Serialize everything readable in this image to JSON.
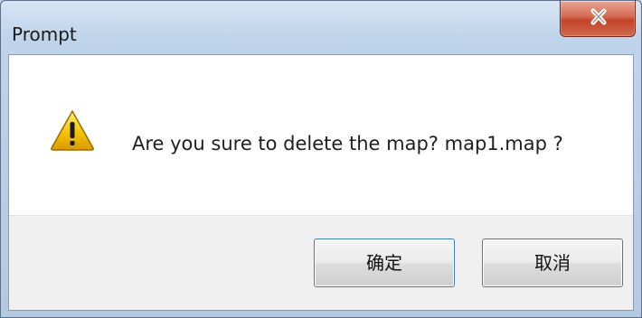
{
  "window": {
    "title": "Prompt"
  },
  "message": {
    "text": "Are you sure to delete the map? map1.map ?",
    "icon": "warning-icon"
  },
  "buttons": {
    "ok_label": "确定",
    "cancel_label": "取消"
  },
  "colors": {
    "close_button": "#c3432a",
    "warning_fill": "#f5c400",
    "button_area": "#f0f0f0",
    "title_bar": "#bfd3ea"
  }
}
